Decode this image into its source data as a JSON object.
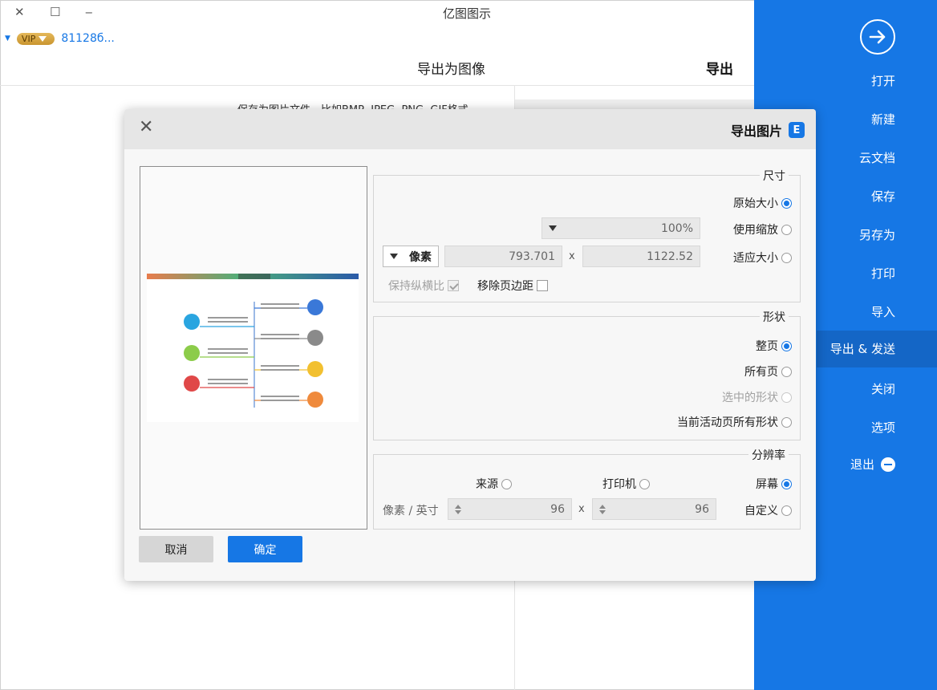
{
  "window": {
    "title": "亿图图示",
    "close_glyph": "✕",
    "maximize_glyph": "☐",
    "minimize_glyph": "‒"
  },
  "user": {
    "vip_label": "VIP",
    "id": "81128б..."
  },
  "header": {
    "export_label": "导出",
    "export_image_label": "导出为图像"
  },
  "background": {
    "description": "保存为图片文件，比如BMP, JPEG, PNG, GIF格式。"
  },
  "sidebar": {
    "items": [
      "打开",
      "新建",
      "云文档",
      "保存",
      "另存为",
      "打印",
      "导入",
      "导出 & 发送",
      "关闭",
      "选项",
      "退出"
    ],
    "active_index": 7,
    "accent_color": "#1677e5"
  },
  "dialog": {
    "title": "导出图片",
    "logo_letter": "E",
    "size_group": {
      "title": "尺寸",
      "original_size": "原始大小",
      "use_zoom": "使用缩放",
      "zoom_value": "100%",
      "fit_size": "适应大小",
      "width_value": "1122.52",
      "height_value": "793.701",
      "x_sep": "x",
      "unit_value": "像素",
      "remove_margin": "移除页边距",
      "keep_ratio": "保持纵横比"
    },
    "shape_group": {
      "title": "形状",
      "whole_page": "整页",
      "all_pages": "所有页",
      "selected_shapes": "选中的形状",
      "current_page_shapes": "当前活动页所有形状"
    },
    "resolution_group": {
      "title": "分辨率",
      "screen": "屏幕",
      "printer": "打印机",
      "source": "来源",
      "custom": "自定义",
      "dpi_x": "96",
      "dpi_y": "96",
      "x_sep": "x",
      "unit_label": "像素 / 英寸"
    },
    "buttons": {
      "ok": "确定",
      "cancel": "取消"
    }
  }
}
